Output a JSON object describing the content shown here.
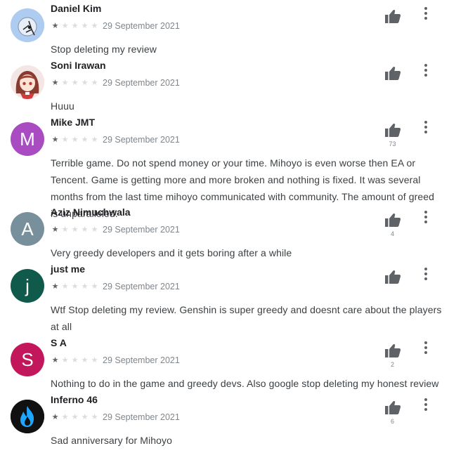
{
  "reviews": [
    {
      "name": "Daniel Kim",
      "stars": 1,
      "date": "29 September 2021",
      "text": "Stop deleting my review",
      "helpful_count": "",
      "avatar": {
        "type": "image",
        "icon": "spider-avatar-icon",
        "bg": "#aecbf0"
      }
    },
    {
      "name": "Soni Irawan",
      "stars": 1,
      "date": "29 September 2021",
      "text": "Huuu",
      "helpful_count": "",
      "avatar": {
        "type": "image",
        "icon": "anime-girl-avatar-icon",
        "bg": "#f3e6e4"
      }
    },
    {
      "name": "Mike JMT",
      "stars": 1,
      "date": "29 September 2021",
      "text": "Terrible game. Do not spend money or your time. Mihoyo is even worse then EA or Tencent. Game is getting more and more broken and nothing is fixed. It was several months from the last time mihoyo communicated with community. The amount of greed is unparalleled.",
      "helpful_count": "73",
      "avatar": {
        "type": "letter",
        "letter": "M",
        "bg": "#a94cc2"
      }
    },
    {
      "name": "Aziz Nimuchwala",
      "stars": 1,
      "date": "29 September 2021",
      "text": "Very greedy developers and it gets boring after a while",
      "helpful_count": "4",
      "avatar": {
        "type": "letter",
        "letter": "A",
        "bg": "#78909c"
      }
    },
    {
      "name": "just me",
      "stars": 1,
      "date": "29 September 2021",
      "text": "Wtf Stop deleting my review. Genshin is super greedy and doesnt care about the players at all",
      "helpful_count": "",
      "avatar": {
        "type": "letter",
        "letter": "j",
        "bg": "#0f5a4b"
      }
    },
    {
      "name": "S A",
      "stars": 1,
      "date": "29 September 2021",
      "text": "Nothing to do in the game and greedy devs. Also google stop deleting my honest review",
      "helpful_count": "2",
      "avatar": {
        "type": "letter",
        "letter": "S",
        "bg": "#c2185b"
      }
    },
    {
      "name": "Inferno 46",
      "stars": 1,
      "date": "29 September 2021",
      "text": "Sad anniversary for Mihoyo",
      "helpful_count": "6",
      "avatar": {
        "type": "image",
        "icon": "blue-flame-avatar-icon",
        "bg": "#111111"
      }
    }
  ],
  "icons": {
    "helpful": "thumbs-up-icon",
    "more": "more-vertical-icon",
    "star": "star-icon"
  },
  "colors": {
    "star_filled": "#5f6368",
    "star_empty": "#dadce0",
    "text": "#3c4043",
    "muted": "#80868b"
  }
}
